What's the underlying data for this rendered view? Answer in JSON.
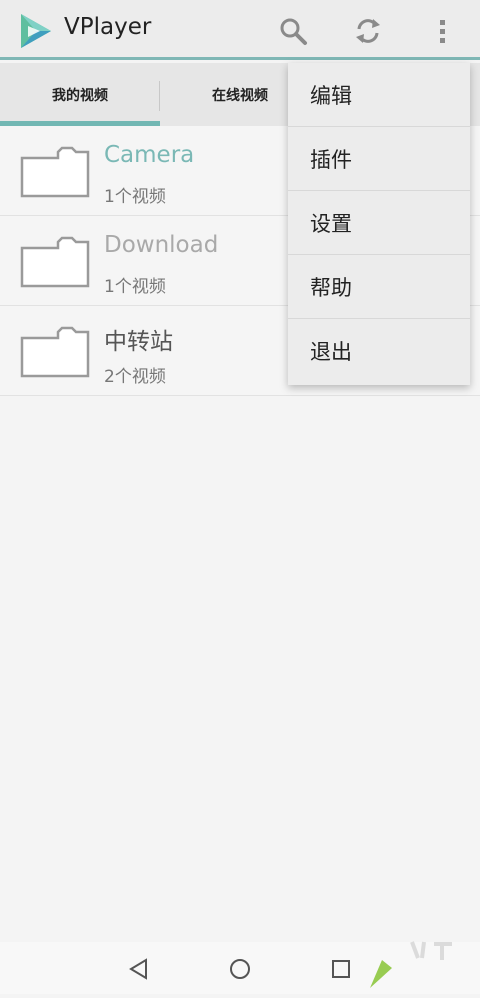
{
  "app": {
    "title": "VPlayer"
  },
  "toolbar": {
    "icons": [
      "search-icon",
      "refresh-icon",
      "more-vert-icon"
    ]
  },
  "tabs": [
    {
      "label": "我的视频",
      "selected": true
    },
    {
      "label": "在线视频",
      "selected": false
    }
  ],
  "folders": [
    {
      "name": "Camera",
      "count": "1个视频",
      "name_color": "#7ab8b5"
    },
    {
      "name": "Download",
      "count": "1个视频",
      "name_color": "#a9a9a9"
    },
    {
      "name": "中转站",
      "count": "2个视频",
      "name_color": "#555555"
    }
  ],
  "menu": {
    "items": [
      "编辑",
      "插件",
      "设置",
      "帮助",
      "退出"
    ]
  },
  "colors": {
    "accent": "#72b7b3",
    "appbar_bg": "#ececec",
    "menu_bg": "#ececec"
  }
}
